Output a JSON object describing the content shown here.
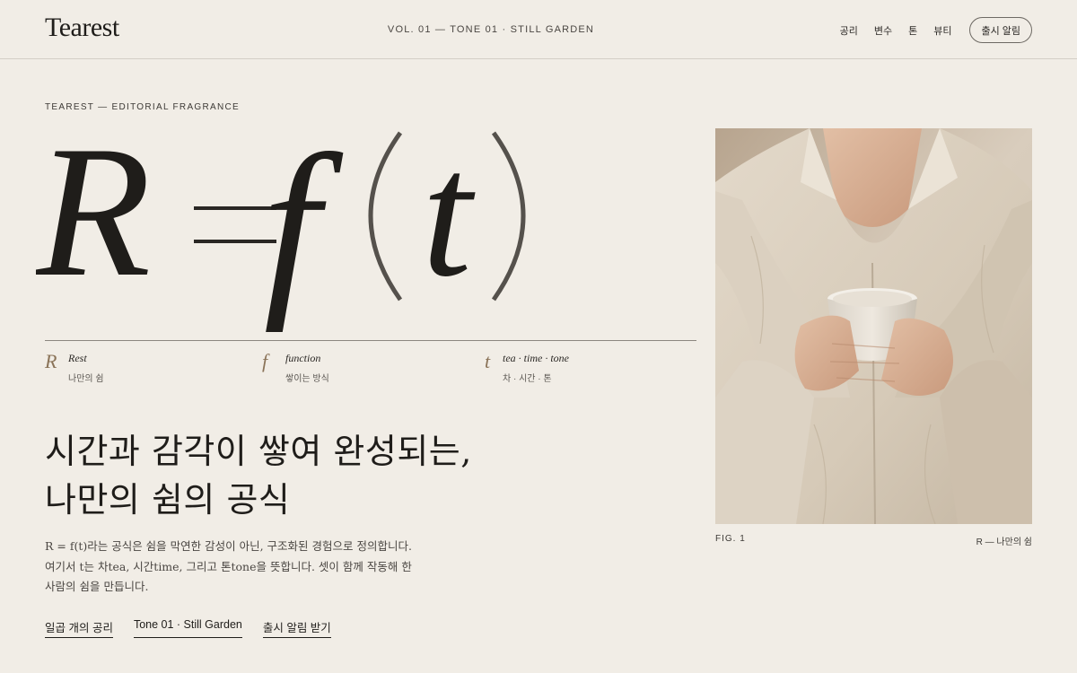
{
  "header": {
    "logo": "Tearest",
    "volume": "VOL. 01 — TONE 01 · STILL GARDEN",
    "nav": [
      "공리",
      "변수",
      "톤",
      "뷰티"
    ],
    "notify_button": "출시 알림"
  },
  "hero": {
    "kicker": "TEAREST — EDITORIAL FRAGRANCE",
    "formula": "R = f(t)",
    "variables": [
      {
        "symbol": "R",
        "english": "Rest",
        "korean": "나만의 쉼"
      },
      {
        "symbol": "f",
        "english": "function",
        "korean": "쌓이는 방식"
      },
      {
        "symbol": "t",
        "english": "tea · time · tone",
        "korean": "차 · 시간 · 톤"
      }
    ],
    "headline_line1": "시간과 감각이 쌓여 완성되는,",
    "headline_line2": "나만의 쉼의 공식",
    "body_line1": "R = f(t)라는 공식은 쉼을 막연한 감성이 아닌, 구조화된 경험으로 정의합니다.",
    "body_line2": "여기서 t는 차tea, 시간time, 그리고 톤tone을 뜻합니다. 셋이 함께 작동해 한",
    "body_line3": "사람의 쉼을 만듭니다.",
    "links": [
      "일곱 개의 공리",
      "Tone 01 · Still Garden",
      "출시 알림 받기"
    ]
  },
  "figure": {
    "label": "FIG. 1",
    "caption": "R — 나만의 쉼"
  },
  "colors": {
    "background": "#f1ede6",
    "ink": "#1f1d1a",
    "accent": "#8a7358",
    "rule": "#d4cfc6"
  }
}
